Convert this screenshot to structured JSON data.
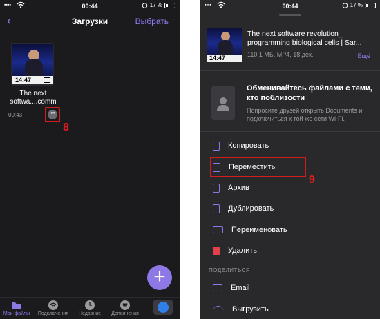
{
  "left": {
    "status": {
      "signal": "▪▪▪▪",
      "time": "00:44",
      "battery": "17 %"
    },
    "nav": {
      "back_icon": "chevron-left-icon",
      "title": "Загрузки",
      "select": "Выбрать"
    },
    "file": {
      "duration": "14:47",
      "name_line1": "The next",
      "name_line2": "softwa....comm",
      "time": "00:43",
      "more_icon": "ellipsis-icon"
    },
    "step_label": "8",
    "fab_icon": "plus-icon",
    "tabs": [
      {
        "label": "Мои файлы",
        "icon": "folder-icon"
      },
      {
        "label": "Подключения",
        "icon": "wifi-icon"
      },
      {
        "label": "Недавние",
        "icon": "clock-icon"
      },
      {
        "label": "Дополнения",
        "icon": "cart-icon"
      }
    ],
    "compass_icon": "compass-icon"
  },
  "right": {
    "status": {
      "signal": "▪▪▪▪",
      "time": "00:44",
      "battery": "17 %"
    },
    "file": {
      "duration": "14:47",
      "title_line1": "The next software revolution_",
      "title_line2": "programming biological cells | Sar...",
      "meta": "110,1 МБ, MP4, 18 дек.",
      "more": "Ещё"
    },
    "share": {
      "title": "Обменивайтесь файлами с теми, кто поблизости",
      "desc": "Попросите друзей открыть Documents и подключиться к той же сети Wi-Fi."
    },
    "actions": {
      "copy": "Копировать",
      "move": "Переместить",
      "archive": "Архив",
      "duplicate": "Дублировать",
      "rename": "Переименовать",
      "delete": "Удалить"
    },
    "share_section": "ПОДЕЛИТЬСЯ",
    "share_actions": {
      "email": "Email",
      "upload": "Выгрузить"
    },
    "step_label": "9"
  }
}
